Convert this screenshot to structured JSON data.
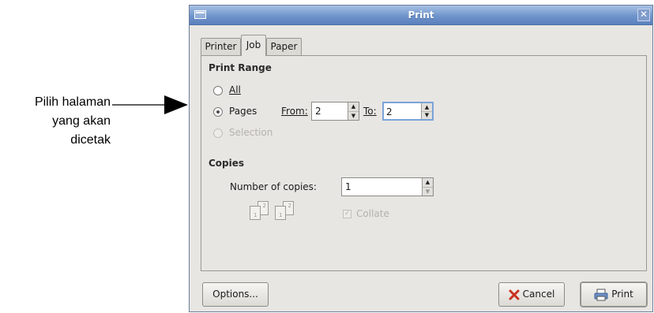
{
  "annotation": {
    "lines": [
      "Pilih halaman",
      "yang akan",
      "dicetak"
    ]
  },
  "window": {
    "title": "Print",
    "close_symbol": "✕",
    "tabs": [
      "Printer",
      "Job",
      "Paper"
    ],
    "active_tab": "Job"
  },
  "print_range": {
    "title": "Print Range",
    "all_label": "All",
    "pages_label": "Pages",
    "from_label": "From:",
    "from_value": "2",
    "to_label": "To:",
    "to_value": "2",
    "selection_label": "Selection",
    "selected": "Pages"
  },
  "copies": {
    "title": "Copies",
    "number_label": "Number of copies:",
    "number_value": "1",
    "collate_label": "Collate",
    "collate_checked": true,
    "collate_enabled": false,
    "page_numbers": [
      "1",
      "2",
      "1",
      "2"
    ]
  },
  "buttons": {
    "options": "Options...",
    "cancel": "Cancel",
    "print": "Print"
  },
  "icons": {
    "cancel": "cancel-x-icon",
    "print": "printer-icon",
    "spin_up": "▲",
    "spin_down": "▼"
  },
  "colors": {
    "titlebar": "#6f94cc",
    "cancel_icon": "#c8321e"
  }
}
